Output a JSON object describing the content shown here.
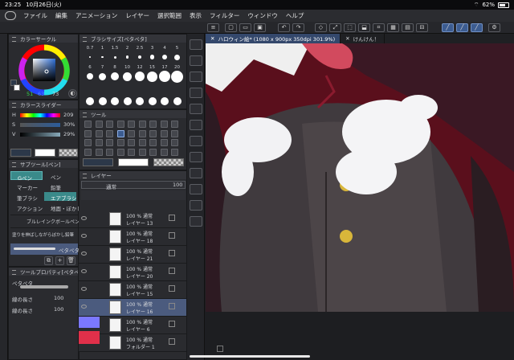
{
  "status": {
    "time": "23:25",
    "date": "10月26日(火)",
    "battery": "62%"
  },
  "menu": [
    "ファイル",
    "編集",
    "アニメーション",
    "レイヤー",
    "選択範囲",
    "表示",
    "フィルター",
    "ウィンドウ",
    "ヘルプ"
  ],
  "color_circle": {
    "title": "カラーサークル",
    "s_val": "51",
    "v_val": "63",
    "h_val": "73"
  },
  "brush_size": {
    "title": "ブラシサイズ[ペタペタ]",
    "row1": [
      "0.7",
      "1",
      "1.5",
      "2",
      "2.5",
      "3",
      "4",
      "5"
    ],
    "row2": [
      "6",
      "7",
      "8",
      "10",
      "12",
      "15",
      "17",
      "20"
    ]
  },
  "color_slider": {
    "title": "カラースライダー",
    "h_label": "H",
    "s_label": "S",
    "v_label": "V",
    "h_val": "209",
    "s_val": "30%",
    "v_val": "29%"
  },
  "tool": {
    "title": "ツール"
  },
  "subtool": {
    "title": "サブツール[ペン]",
    "items": [
      {
        "left": "Gペン",
        "right": "ペン"
      },
      {
        "left": "マーカー",
        "right": "鉛筆"
      },
      {
        "left": "筆ブラシ",
        "right": "エアブラシ"
      },
      {
        "left": "アクション",
        "right": "地面・ぼかし"
      }
    ],
    "brushes": [
      "ブルレインクボールペン",
      "塗りを伸ばしながらぼかし鉛筆",
      "ペタペタ"
    ]
  },
  "tool_property": {
    "title": "ツールプロパティ[ペタペタ]",
    "brush_name": "ペタペタ",
    "rows": [
      {
        "label": "線の長さ",
        "value": "100"
      },
      {
        "label": "線の長さ",
        "value": "100"
      }
    ]
  },
  "layer_panel": {
    "title": "レイヤー",
    "blend": "通常",
    "opacity": "100",
    "layers": [
      {
        "pct": "100 % 通常",
        "name": "レイヤー 13"
      },
      {
        "pct": "100 % 通常",
        "name": "レイヤー 18"
      },
      {
        "pct": "100 % 通常",
        "name": "レイヤー 21"
      },
      {
        "pct": "100 % 通常",
        "name": "レイヤー 20"
      },
      {
        "pct": "100 % 通常",
        "name": "レイヤー 15"
      },
      {
        "pct": "100 % 通常",
        "name": "レイヤー 16"
      },
      {
        "pct": "100 % 通常",
        "name": "レイヤー 6"
      },
      {
        "pct": "100 % 通常",
        "name": "フォルダー 1"
      }
    ]
  },
  "tabs": [
    {
      "label": "ハロウィン絵* (1080 x 900px 350dpi 301.9%)"
    },
    {
      "label": "けんけん！"
    }
  ],
  "colors": {
    "main": "#2c3849",
    "sub": "#ffffff",
    "accent": "#3c5c90"
  }
}
